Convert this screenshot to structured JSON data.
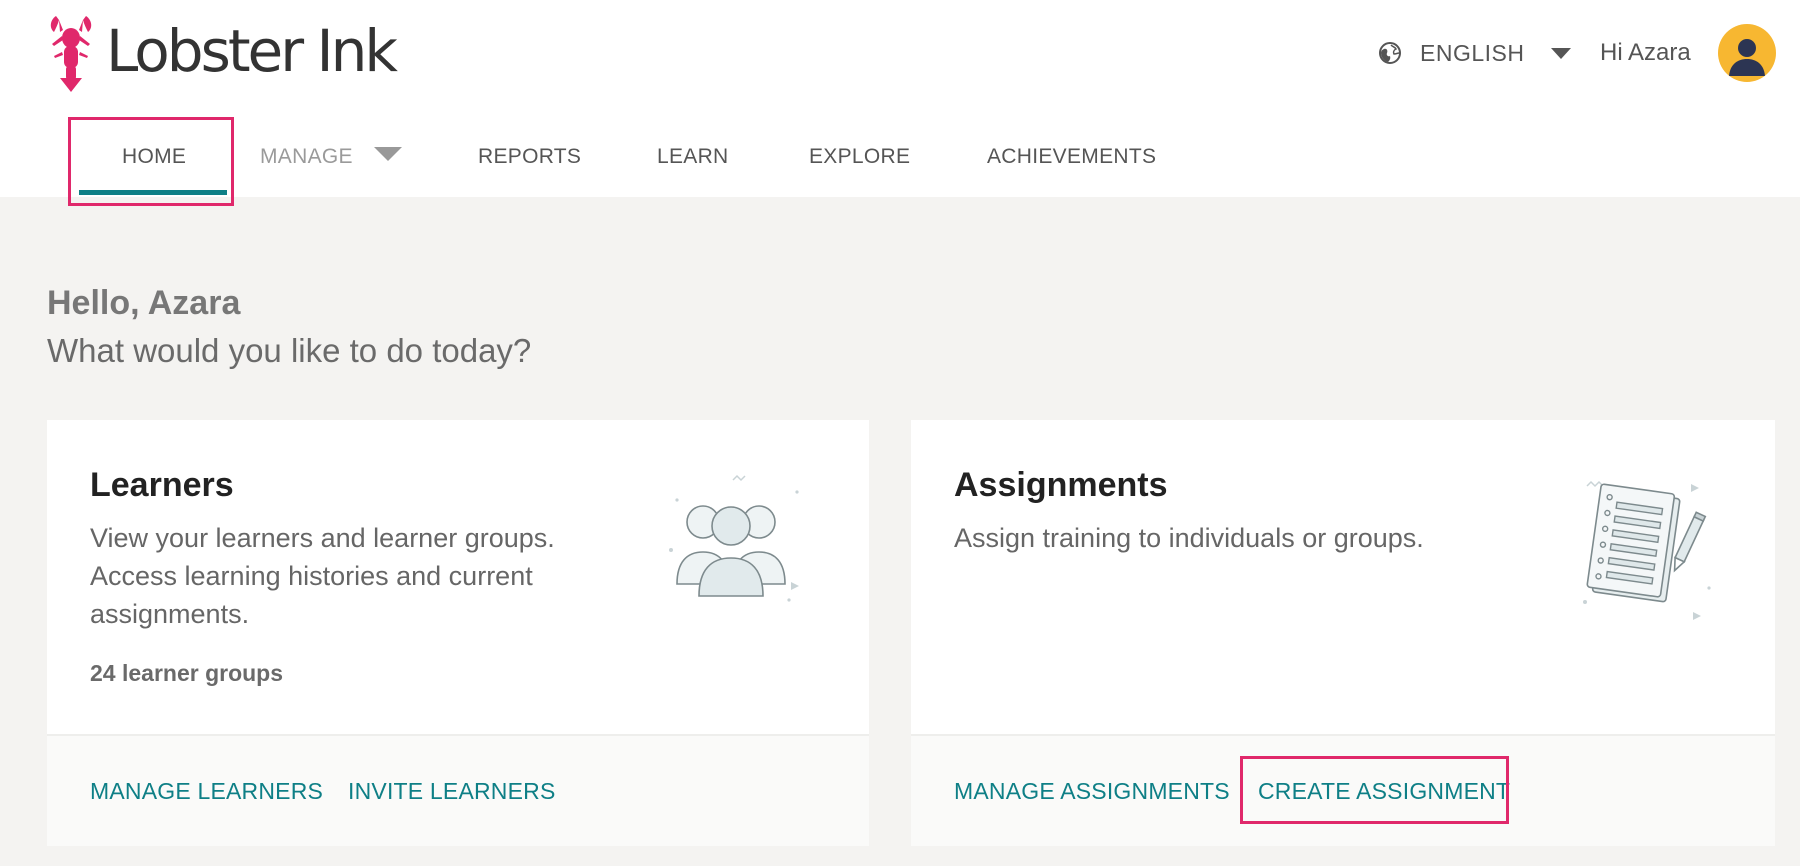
{
  "app": {
    "logo_text": "Lobster Ink"
  },
  "header": {
    "language": "ENGLISH",
    "greeting": "Hi Azara"
  },
  "nav": {
    "items": [
      {
        "label": "HOME",
        "active": true
      },
      {
        "label": "MANAGE",
        "muted": true
      },
      {
        "label": "REPORTS"
      },
      {
        "label": "LEARN"
      },
      {
        "label": "EXPLORE"
      },
      {
        "label": "ACHIEVEMENTS"
      }
    ]
  },
  "welcome": {
    "hello": "Hello, Azara",
    "question": "What would you like to do today?"
  },
  "cards": {
    "learners": {
      "title": "Learners",
      "description": "View your learners and learner groups. Access learning histories and current assignments.",
      "stat": "24 learner groups",
      "links": [
        "MANAGE LEARNERS",
        "INVITE LEARNERS"
      ]
    },
    "assignments": {
      "title": "Assignments",
      "description": "Assign training to individuals or groups.",
      "links": [
        "MANAGE ASSIGNMENTS",
        "CREATE ASSIGNMENT"
      ]
    }
  },
  "colors": {
    "brand": "#e0286b",
    "accent": "#0e7f86",
    "avatar_bg": "#f7b731",
    "page_bg": "#f4f3f1"
  },
  "icons": {
    "logo": "lobster-icon",
    "language": "globe-icon",
    "avatar": "user-avatar-icon",
    "learners": "people-group-icon",
    "assignments": "notepad-pencil-icon"
  }
}
